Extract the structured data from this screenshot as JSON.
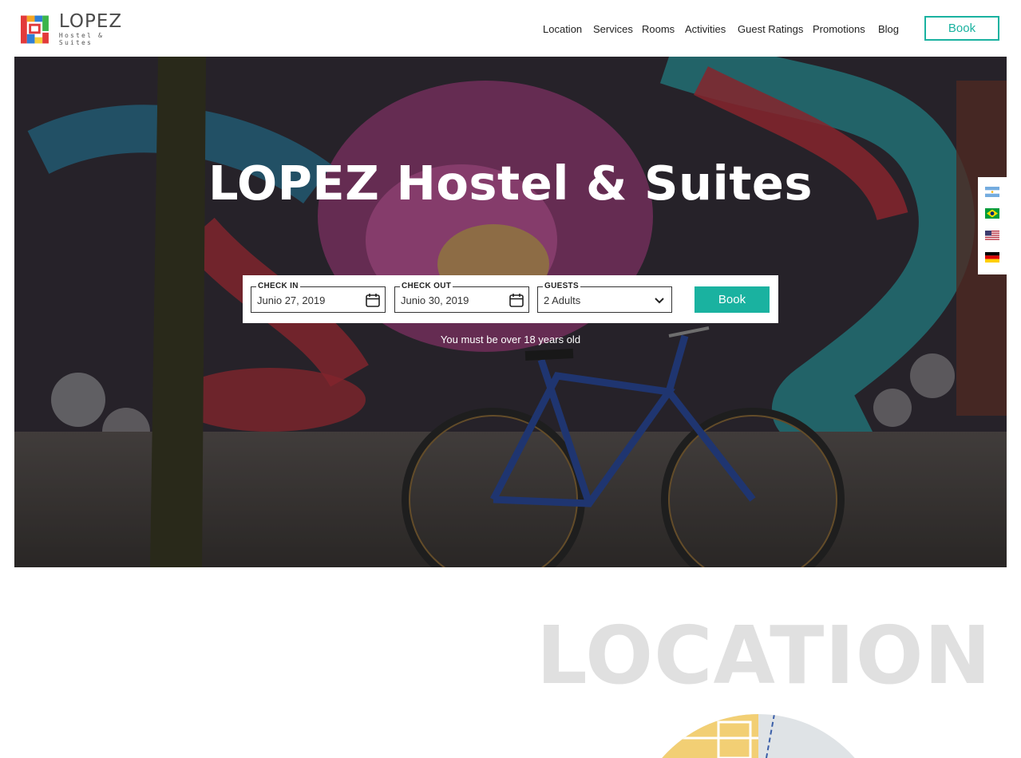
{
  "brand": {
    "name": "LOPEZ",
    "tagline": "Hostel & Suites"
  },
  "nav": {
    "items": [
      "Location",
      "Services",
      "Rooms",
      "Activities",
      "Guest Ratings",
      "Promotions",
      "Blog"
    ],
    "book_label": "Book"
  },
  "hero": {
    "title": "LOPEZ Hostel & Suites",
    "check_in": {
      "label": "CHECK IN",
      "value": "Junio 27, 2019",
      "icon": "calendar-icon"
    },
    "check_out": {
      "label": "CHECK OUT",
      "value": "Junio 30, 2019",
      "icon": "calendar-icon"
    },
    "guests": {
      "label": "GUESTS",
      "value": "2 Adults",
      "icon": "chevron-down-icon"
    },
    "book_label": "Book",
    "age_note": "You must be over 18 years old"
  },
  "languages": [
    "argentina-flag-icon",
    "brazil-flag-icon",
    "usa-flag-icon",
    "germany-flag-icon"
  ],
  "location": {
    "title": "LOCATION"
  },
  "colors": {
    "accent": "#1ab2a0",
    "section_title": "#e0e0e0"
  }
}
